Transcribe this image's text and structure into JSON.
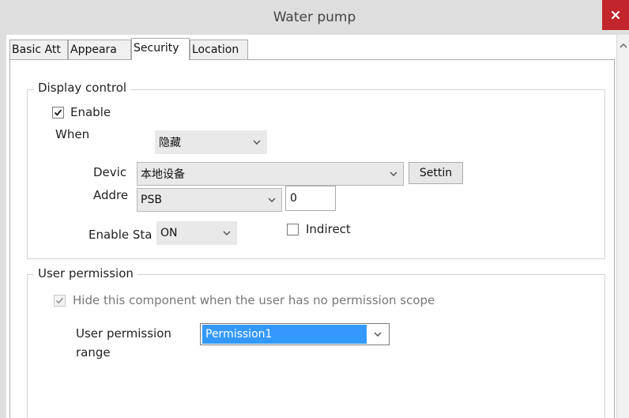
{
  "window": {
    "title": "Water pump",
    "close_icon": "close-icon"
  },
  "tabs": [
    {
      "label": "Basic Att"
    },
    {
      "label": "Appeara"
    },
    {
      "label": "Security"
    },
    {
      "label": "Location"
    }
  ],
  "active_tab": "Security",
  "display_control": {
    "title": "Display control",
    "enable_label": "Enable",
    "enable_checked": true,
    "when_label": "When",
    "when_value": "隐藏",
    "device_label": "Devic",
    "device_value": "本地设备",
    "settings_label": "Settin",
    "address_label": "Addre",
    "address_type": "PSB",
    "address_value": "0",
    "enable_state_label": "Enable Sta",
    "enable_state_value": "ON",
    "indirect_label": "Indirect",
    "indirect_checked": false
  },
  "user_permission": {
    "title": "User permission",
    "hide_label": "Hide this component when the user has no permission scope",
    "hide_checked": true,
    "range_label_line1": "User permission",
    "range_label_line2": "range",
    "range_value": "Permission1"
  },
  "colors": {
    "titlebar": "#dedede",
    "close_button": "#c2252b",
    "selection": "#3399ff"
  }
}
